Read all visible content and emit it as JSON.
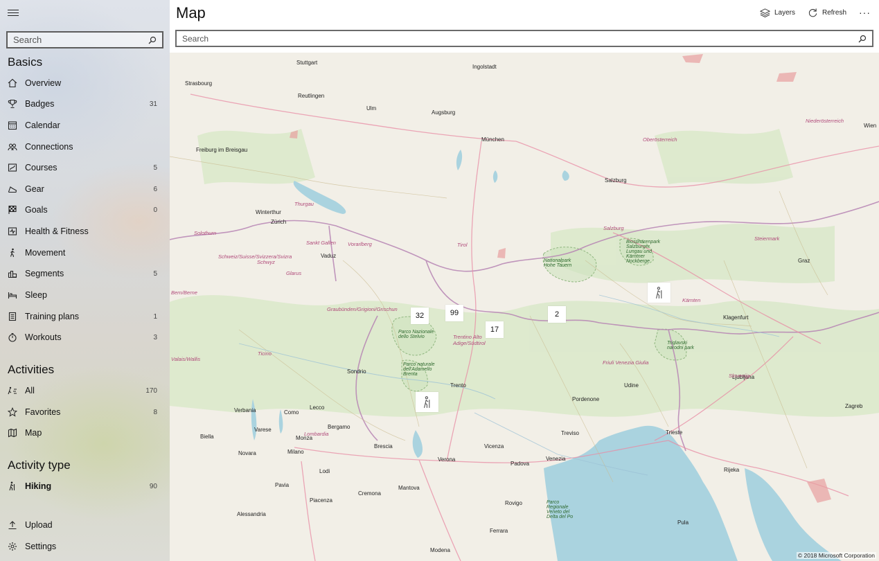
{
  "sidebar": {
    "search_placeholder": "Search",
    "sections": {
      "basics": "Basics",
      "activities": "Activities",
      "activity_type": "Activity type"
    },
    "basics": [
      {
        "label": "Overview",
        "icon": "home-icon",
        "count": ""
      },
      {
        "label": "Badges",
        "icon": "trophy-icon",
        "count": "31"
      },
      {
        "label": "Calendar",
        "icon": "calendar-icon",
        "count": ""
      },
      {
        "label": "Connections",
        "icon": "connections-icon",
        "count": ""
      },
      {
        "label": "Courses",
        "icon": "map-course-icon",
        "count": "5"
      },
      {
        "label": "Gear",
        "icon": "shoe-icon",
        "count": "6"
      },
      {
        "label": "Goals",
        "icon": "checkered-flag-icon",
        "count": "0"
      },
      {
        "label": "Health & Fitness",
        "icon": "health-icon",
        "count": ""
      },
      {
        "label": "Movement",
        "icon": "walking-icon",
        "count": ""
      },
      {
        "label": "Segments",
        "icon": "segments-icon",
        "count": "5"
      },
      {
        "label": "Sleep",
        "icon": "bed-icon",
        "count": ""
      },
      {
        "label": "Training plans",
        "icon": "clipboard-icon",
        "count": "1"
      },
      {
        "label": "Workouts",
        "icon": "stopwatch-icon",
        "count": "3"
      }
    ],
    "activities": [
      {
        "label": "All",
        "icon": "all-activities-icon",
        "count": "170"
      },
      {
        "label": "Favorites",
        "icon": "star-icon",
        "count": "8"
      },
      {
        "label": "Map",
        "icon": "map-icon",
        "count": ""
      }
    ],
    "activity_types": [
      {
        "label": "Hiking",
        "icon": "hiking-icon",
        "count": "90"
      }
    ],
    "footer": [
      {
        "label": "Upload",
        "icon": "upload-icon"
      },
      {
        "label": "Settings",
        "icon": "gear-icon"
      }
    ]
  },
  "header": {
    "title": "Map",
    "layers_label": "Layers",
    "refresh_label": "Refresh",
    "more_label": "···",
    "search_placeholder": "Search"
  },
  "map": {
    "cluster_markers": [
      "32",
      "99",
      "17",
      "2"
    ],
    "hiking_markers": 2,
    "copyright": "© 2018 Microsoft Corporation",
    "city_labels": [
      "Stuttgart",
      "Strasbourg",
      "Ingolstadt",
      "Augsburg",
      "München",
      "Reutlingen",
      "Ulm",
      "Freiburg im Breisgau",
      "Winterthur",
      "Zürich",
      "Vaduz",
      "Salzburg",
      "Wien",
      "Graz",
      "Klagenfurt",
      "Trento",
      "Sondrio",
      "Verbania",
      "Varese",
      "Como",
      "Lecco",
      "Bergamo",
      "Brescia",
      "Milano",
      "Monza",
      "Pavia",
      "Lodi",
      "Cremona",
      "Verona",
      "Vicenza",
      "Padova",
      "Venezia",
      "Treviso",
      "Pordenone",
      "Udine",
      "Trieste",
      "Ljubljana",
      "Zagreb",
      "Rijeka",
      "Pula",
      "Rovigo",
      "Ferrara",
      "Piacenza",
      "Alessandria",
      "Biella",
      "Novara",
      "Modena",
      "Mantova"
    ],
    "region_labels": [
      "Oberösterreich",
      "Niederösterreich",
      "Steiermark",
      "Kärnten",
      "Tirol",
      "Vorarlberg",
      "Sankt Gallen",
      "Thurgau",
      "Schwyz",
      "Glarus",
      "Ticino",
      "Lombardia",
      "Salzburg",
      "Slovenija",
      "Friuli Venezia Giulia",
      "Trentino Alto Adige/Südtirol",
      "Graubünden/Grigioni/Grischun",
      "Schweiz/Suisse/Svizzera/Svizra",
      "Valais/Wallis",
      "Bern/Berne",
      "Solothurn"
    ],
    "park_labels": [
      "Parco Nazionale dello Stelvio",
      "Parco naturale dell'Adamello Brenta",
      "Nationalpark Hohe Tauern",
      "Biosphärenpark Salzburger Lungau und Kärntner Nockberge",
      "Triglavski narodni park",
      "Parco Regionale Veneto del Delta del Po"
    ]
  }
}
